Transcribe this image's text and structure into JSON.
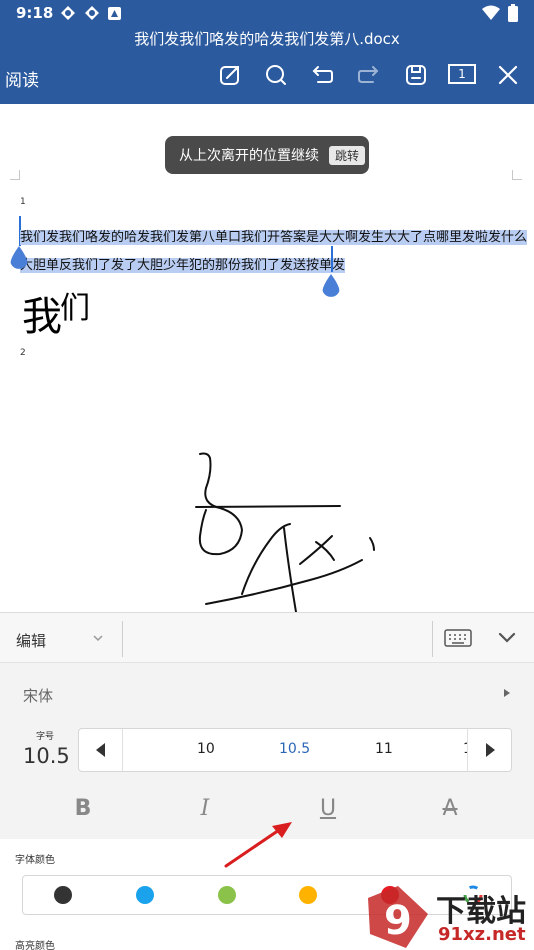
{
  "status_bar": {
    "time": "9:18",
    "icons": [
      "app-icon",
      "app-icon",
      "notification-icon"
    ],
    "right_icons": [
      "wifi-icon",
      "battery-icon"
    ]
  },
  "header": {
    "title": "我们发我们咯发的哈发我们发第八.docx",
    "mode": "阅读",
    "tools": [
      "edit-icon",
      "search-icon",
      "undo-icon",
      "redo-icon",
      "save-icon",
      "page-count-icon",
      "close-icon"
    ],
    "page_count": "1",
    "background": "#2b5a9e"
  },
  "document": {
    "toast_text": "从上次离开的位置继续",
    "toast_button": "跳转",
    "page_numbers": [
      "1",
      "2"
    ],
    "lines": [
      "我们发我们咯发的哈发我们发第八单口我们开答案是大大啊发生大大了点哪里发啦发什么",
      "大胆单反我们了发了大胆少年犯的那份我们了发送按单发"
    ],
    "big_text": "我",
    "big_text_small": "们",
    "selection_color": "#b9cdf3"
  },
  "edit_panel": {
    "mode_label": "编辑",
    "font_name": "宋体",
    "size_label": "字号",
    "size_value": "10.5",
    "size_options": [
      "10",
      "10.5",
      "11",
      "1"
    ],
    "selected_size": "10.5",
    "format_buttons": [
      "B",
      "I",
      "U",
      "A"
    ],
    "color_label": "字体颜色",
    "colors": [
      "#333333",
      "#1aa3ec",
      "#8bc34a",
      "#ffb300",
      "#e51c23"
    ],
    "highlight_label": "高亮颜色"
  },
  "watermark": {
    "main": "下载站",
    "sub": "91xz.net",
    "mark": "9"
  }
}
